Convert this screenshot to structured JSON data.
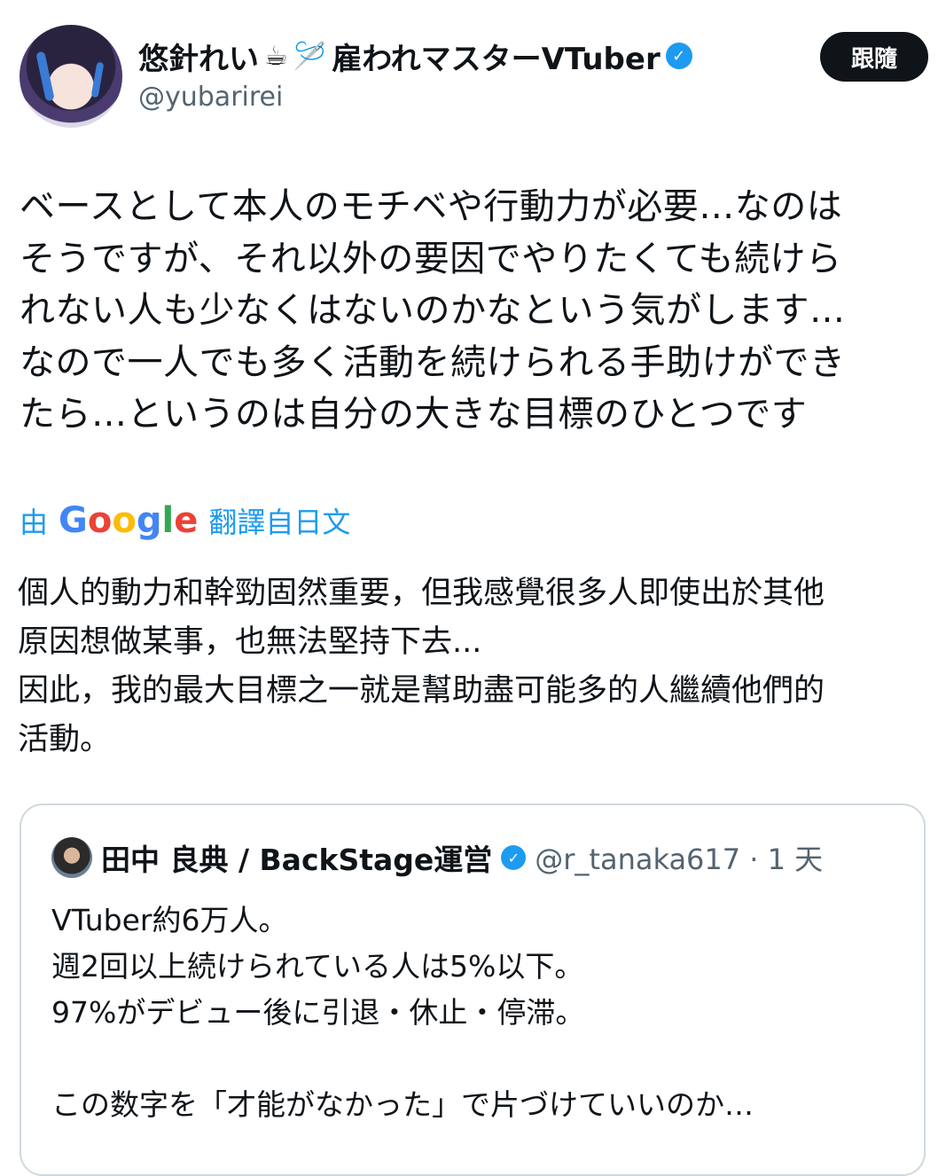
{
  "author": {
    "display_name": "悠針れい",
    "emoji_1": "☕",
    "emoji_2": "🪡",
    "display_suffix": "雇われマスターVTuber",
    "handle": "@yubarirei",
    "avatar_icon": "anime-avatar-icon",
    "verified_icon": "verified-badge-icon"
  },
  "follow_button": {
    "label": "跟隨"
  },
  "tweet": {
    "text": "ベースとして本人のモチベや行動力が必要…なのは\nそうですが、それ以外の要因でやりたくても続けら\nれない人も少なくはないのかなという気がします…\nなので一人でも多く活動を続けられる手助けができ\nたら…というのは自分の大きな目標のひとつです"
  },
  "translation": {
    "prefix": "由",
    "provider_letters": [
      "G",
      "o",
      "o",
      "g",
      "l",
      "e"
    ],
    "suffix": "翻譯自日文",
    "text": "個人的動力和幹勁固然重要，但我感覺很多人即使出於其他\n原因想做某事，也無法堅持下去...\n因此，我的最大目標之一就是幫助盡可能多的人繼續他們的\n活動。"
  },
  "quoted_tweet": {
    "author_name": "田中 良典 / BackStage運営",
    "handle_time": "@r_tanaka617 · 1 天",
    "body": "VTuber約6万人。\n週2回以上続けられている人は5%以下。\n97%がデビュー後に引退・休止・停滞。\n\nこの数字を「才能がなかった」で片づけていいのか…"
  },
  "colors": {
    "accent": "#1d9bf0",
    "text": "#0f1419",
    "secondary": "#536471",
    "border": "#cfd9de"
  }
}
